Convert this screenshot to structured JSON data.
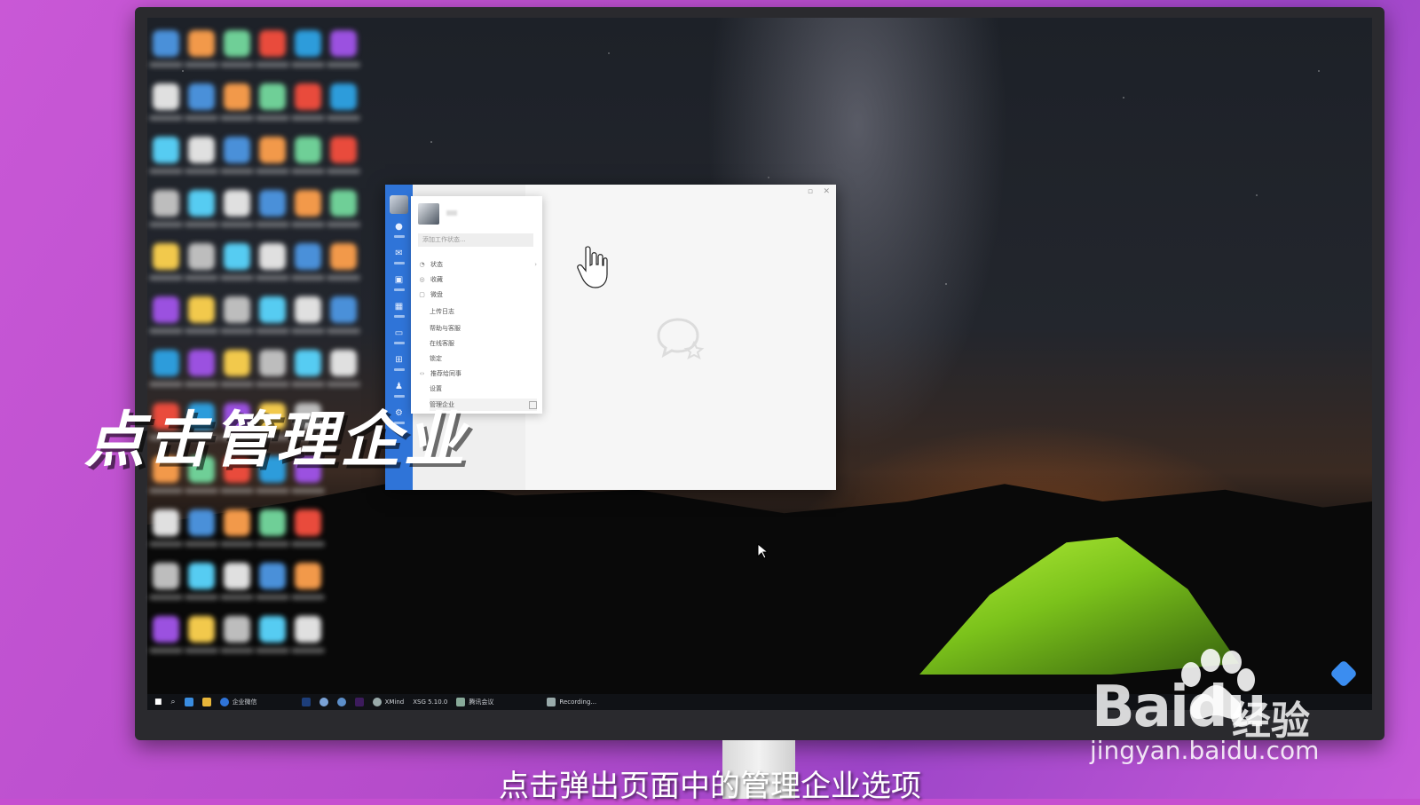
{
  "overlay": {
    "headline": "点击管理企业",
    "subtitle": "点击弹出页面中的管理企业选项"
  },
  "watermark": {
    "brand": "Baidu",
    "brand_cn": "经验",
    "url": "jingyan.baidu.com"
  },
  "app": {
    "name": "企业微信",
    "window_controls": [
      "minimize-icon",
      "close-icon"
    ],
    "rail_items": [
      {
        "icon": "message-icon"
      },
      {
        "icon": "mail-icon"
      },
      {
        "icon": "docs-icon"
      },
      {
        "icon": "calendar-icon"
      },
      {
        "icon": "meeting-icon"
      },
      {
        "icon": "workbench-icon"
      },
      {
        "icon": "contacts-icon"
      },
      {
        "icon": "more-icon"
      }
    ],
    "menu": {
      "search_placeholder": "添加工作状态...",
      "items": [
        {
          "icon": "status-icon",
          "label": "状态",
          "chevron": true
        },
        {
          "icon": "favorites-icon",
          "label": "收藏"
        },
        {
          "icon": "folder-icon",
          "label": "微盘"
        },
        {
          "label": "上传日志",
          "sub": true
        },
        {
          "label": "帮助与客服",
          "sub": true
        },
        {
          "label": "在线客服",
          "sub": true
        },
        {
          "label": "锁定",
          "sub": true
        },
        {
          "icon": "share-icon",
          "label": "推荐给同事"
        },
        {
          "label": "设置",
          "sub": true
        },
        {
          "label": "管理企业",
          "sub": true,
          "external": true
        }
      ]
    }
  },
  "taskbar": {
    "items": [
      "企业微信",
      "XMind",
      "XSG 5.10.0",
      "腾讯会议",
      "Recording..."
    ]
  },
  "colors": {
    "rail": "#2f74d8",
    "background": "#c54fd0"
  }
}
